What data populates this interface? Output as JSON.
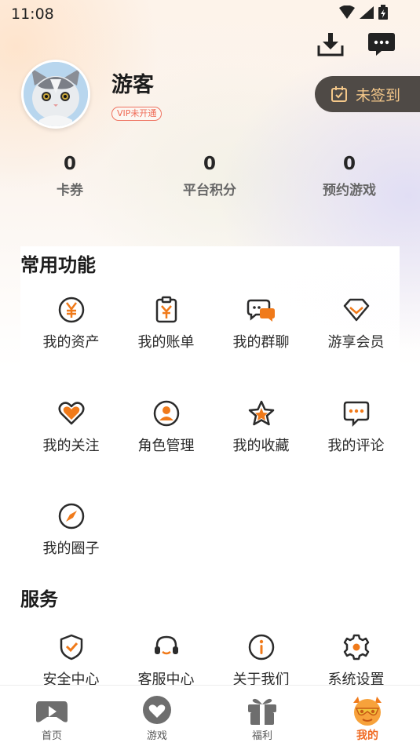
{
  "status_bar": {
    "time": "11:08"
  },
  "profile": {
    "username": "游客",
    "vip_badge": "VIP未开通",
    "checkin_label": "未签到"
  },
  "stats": [
    {
      "value": "0",
      "label": "卡券"
    },
    {
      "value": "0",
      "label": "平台积分"
    },
    {
      "value": "0",
      "label": "预约游戏"
    }
  ],
  "common_functions": {
    "title": "常用功能",
    "items": [
      {
        "label": "我的资产",
        "icon": "yuan-coin-icon"
      },
      {
        "label": "我的账单",
        "icon": "bill-icon"
      },
      {
        "label": "我的群聊",
        "icon": "group-chat-icon"
      },
      {
        "label": "游享会员",
        "icon": "diamond-icon"
      },
      {
        "label": "我的关注",
        "icon": "heart-icon"
      },
      {
        "label": "角色管理",
        "icon": "user-icon"
      },
      {
        "label": "我的收藏",
        "icon": "star-icon"
      },
      {
        "label": "我的评论",
        "icon": "comment-icon"
      },
      {
        "label": "我的圈子",
        "icon": "compass-icon"
      }
    ]
  },
  "services": {
    "title": "服务",
    "items": [
      {
        "label": "安全中心",
        "icon": "shield-icon"
      },
      {
        "label": "客服中心",
        "icon": "headset-icon"
      },
      {
        "label": "关于我们",
        "icon": "info-icon"
      },
      {
        "label": "系统设置",
        "icon": "gear-icon"
      }
    ]
  },
  "tabbar": [
    {
      "label": "首页",
      "icon": "gamepad-icon",
      "active": false
    },
    {
      "label": "游戏",
      "icon": "game-chat-icon",
      "active": false
    },
    {
      "label": "福利",
      "icon": "gift-icon",
      "active": false
    },
    {
      "label": "我的",
      "icon": "profile-face-icon",
      "active": true
    }
  ],
  "colors": {
    "accent": "#f07a1a",
    "checkin_bg": "#4f4a46",
    "checkin_text": "#f5c88a",
    "vip": "#ef6a55"
  }
}
